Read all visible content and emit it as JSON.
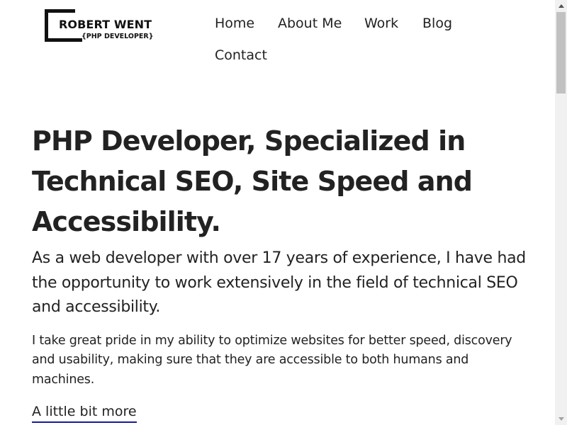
{
  "logo": {
    "name": "ROBERT WENT",
    "tagline": "{PHP DEVELOPER}"
  },
  "nav": {
    "items": [
      {
        "label": "Home"
      },
      {
        "label": "About Me"
      },
      {
        "label": "Work"
      },
      {
        "label": "Blog"
      },
      {
        "label": "Contact"
      }
    ]
  },
  "hero": {
    "title": "PHP Developer, Specialized in Technical SEO, Site Speed and Accessibility.",
    "lead": "As a web developer with over 17 years of experience, I have had the opportunity to work extensively in the field of technical SEO and accessibility.",
    "body": "I take great pride in my ability to optimize websites for better speed, discovery and usability, making sure that they are accessible to both humans and machines.",
    "more_link": "A little bit more"
  },
  "colors": {
    "text": "#222222",
    "link_underline": "#1a1a99",
    "background": "#ffffff"
  }
}
